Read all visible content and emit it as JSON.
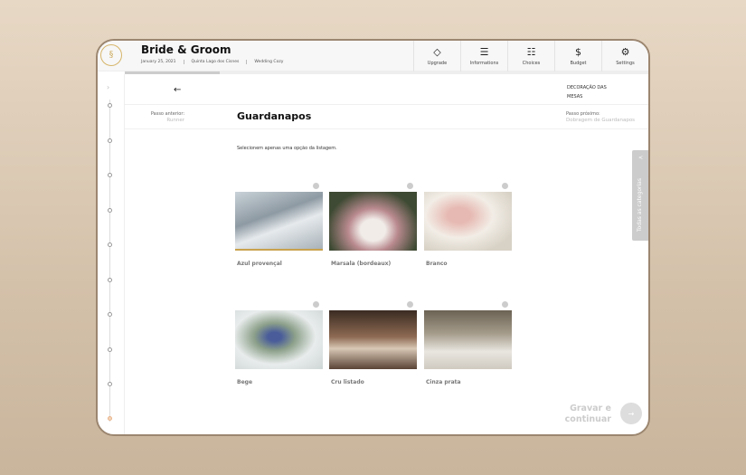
{
  "header": {
    "logo_text": "SLC",
    "title": "Bride & Groom",
    "date": "January 25, 2021",
    "venue": "Quinta Lago dos Cisnes",
    "company": "Wedding Cozy"
  },
  "nav": [
    {
      "label": "Upgrade",
      "icon": "diamond-icon"
    },
    {
      "label": "Informations",
      "icon": "lines-icon"
    },
    {
      "label": "Choices",
      "icon": "checklist-icon"
    },
    {
      "label": "Budget",
      "icon": "dollar-icon"
    },
    {
      "label": "Settings",
      "icon": "sliders-icon"
    }
  ],
  "progress_percent": 18,
  "step": {
    "back_arrow": "←",
    "prev_label": "Passo anterior:",
    "prev_value": "Runner",
    "title": "Guardanapos",
    "next_category": "DECORAÇÃO DAS MESAS",
    "next_label": "Passo próximo:",
    "next_value": "Dobragem de Guardanapos",
    "instruction": "Selecionem apenas uma opção da listagem."
  },
  "options": [
    {
      "label": "Azul provençal"
    },
    {
      "label": "Marsala (bordeaux)"
    },
    {
      "label": "Branco"
    },
    {
      "label": "Bege"
    },
    {
      "label": "Cru listado"
    },
    {
      "label": "Cinza prata"
    }
  ],
  "side_tab": {
    "label": "Todas as categorias"
  },
  "save": {
    "label": "Gravar e continuar"
  }
}
